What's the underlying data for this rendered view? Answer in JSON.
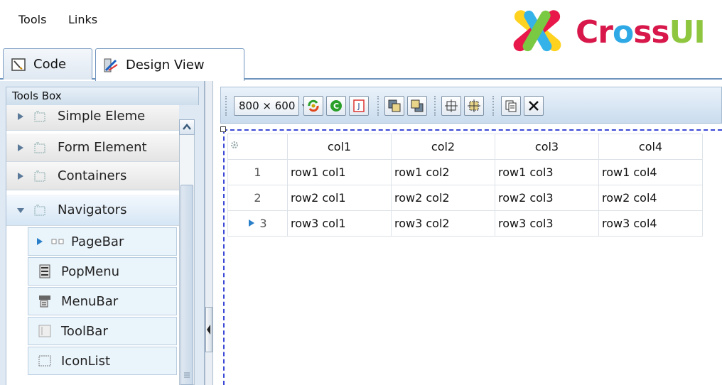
{
  "menu": {
    "tools": "Tools",
    "links": "Links"
  },
  "logo": {
    "text_cross": "Cr",
    "text_o": "o",
    "text_ss": "ss",
    "text_ui": "UI"
  },
  "tabs": [
    {
      "label": "Code",
      "icon": "code-icon",
      "active": false
    },
    {
      "label": "Design View",
      "icon": "design-icon",
      "active": true
    }
  ],
  "toolbox": {
    "title": "Tools Box",
    "groups": [
      {
        "label": "Simple Eleme",
        "expanded": false
      },
      {
        "label": "Form Element",
        "expanded": false
      },
      {
        "label": "Containers",
        "expanded": false
      },
      {
        "label": "Navigators",
        "expanded": true
      }
    ],
    "items": [
      {
        "label": "PageBar",
        "icon": "pagebar-icon"
      },
      {
        "label": "PopMenu",
        "icon": "popmenu-icon"
      },
      {
        "label": "MenuBar",
        "icon": "menubar-icon"
      },
      {
        "label": "ToolBar",
        "icon": "toolbar-icon"
      },
      {
        "label": "IconList",
        "icon": "iconlist-icon"
      }
    ]
  },
  "toolbar": {
    "size": "800 × 600"
  },
  "grid": {
    "columns": [
      "col1",
      "col2",
      "col3",
      "col4"
    ],
    "rows": [
      {
        "num": "1",
        "cells": [
          "row1 col1",
          "row1 col2",
          "row1 col3",
          "row1 col4"
        ],
        "current": false
      },
      {
        "num": "2",
        "cells": [
          "row2 col1",
          "row2 col2",
          "row2 col3",
          "row2 col4"
        ],
        "current": false
      },
      {
        "num": "3",
        "cells": [
          "row3 col1",
          "row3 col2",
          "row3 col3",
          "row3 col4"
        ],
        "current": true
      }
    ]
  },
  "colors": {
    "accent": "#3b49d6",
    "tab_border": "#6f94bd"
  }
}
